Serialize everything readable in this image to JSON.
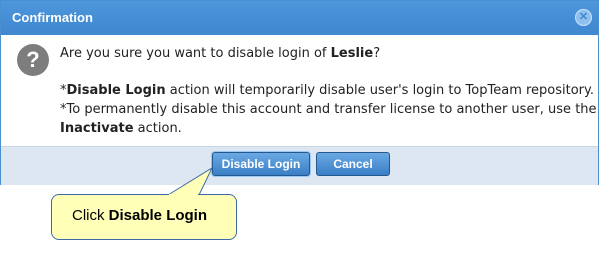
{
  "dialog": {
    "title": "Confirmation",
    "close_glyph": "✕",
    "question_glyph": "?",
    "question": {
      "prefix": "Are you sure you want to disable login of ",
      "user": "Leslie",
      "suffix": "?"
    },
    "note1": {
      "bullet": "*",
      "action": "Disable Login",
      "text": " action will temporarily disable user's login to TopTeam repository."
    },
    "note2": {
      "line1": "*To permanently disable this account and transfer license to another user, use the",
      "action": "Inactivate",
      "text": " action."
    },
    "buttons": {
      "disable_login": "Disable Login",
      "cancel": "Cancel"
    }
  },
  "callout": {
    "prefix": "Click ",
    "target": "Disable Login"
  },
  "colors": {
    "titlebar": "#3f87cf",
    "button": "#3a7fc6",
    "footer": "#dde7f1",
    "callout_bg": "#ffffb8"
  }
}
